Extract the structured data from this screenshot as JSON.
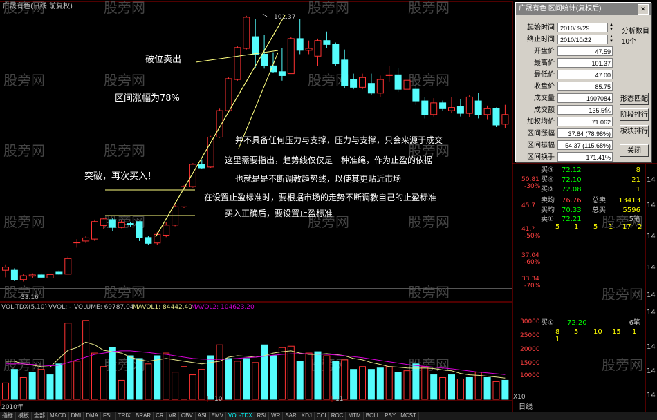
{
  "chart_header": {
    "title": "广晟有色(日线 前复权)",
    "high_marker": "101.37",
    "low_marker": "33.16"
  },
  "watermark": "股旁网",
  "annotations": [
    "破位卖出",
    "区间涨幅为78%",
    "并不具备任何压力与支撑，压力与支撑，只会来源于成交",
    "这里需要指出，趋势线仅仅是一种准绳，作为止盈的依据",
    "也就是是不断调教趋势线，以使其更贴近市场",
    "突破，再次买入！",
    "在设置止盈标准时，要根据市场的走势不断调教自己的止盈标准",
    "买入正确后，要设置止盈标准"
  ],
  "right_axis": [
    {
      "price": "50.81",
      "pct": "-30%"
    },
    {
      "price": "45.7",
      "pct": ""
    },
    {
      "price": "41.?",
      "pct": "-50%"
    },
    {
      "price": "37.04",
      "pct": "-60%"
    },
    {
      "price": "33.34",
      "pct": "-70%"
    }
  ],
  "vol_header": {
    "name": "VOL-TDX(5,10)",
    "vvol": "VVOL: -",
    "volume": "VOLUME: 69787.04",
    "mavol1": "MAVOL1: 84442.40",
    "mavol2": "MAVOL2: 104623.20"
  },
  "vol_axis": [
    "30000",
    "25000",
    "20000",
    "15000",
    "10000",
    "X10"
  ],
  "date_labels": [
    "2010年",
    "10",
    "11"
  ],
  "period_label": "日线",
  "dialog": {
    "title": "广晟有色 区间统计(复权后)",
    "rows": [
      {
        "label": "起始时间",
        "value": "2010/ 9/29"
      },
      {
        "label": "终止时间",
        "value": "2010/10/22"
      },
      {
        "label": "开盘价",
        "value": "47.59"
      },
      {
        "label": "最高价",
        "value": "101.37"
      },
      {
        "label": "最低价",
        "value": "47.00"
      },
      {
        "label": "收盘价",
        "value": "85.75"
      },
      {
        "label": "成交量",
        "value": "1907084"
      },
      {
        "label": "成交额",
        "value": "135.5亿"
      },
      {
        "label": "加权均价",
        "value": "71.062"
      },
      {
        "label": "区间涨幅",
        "value": "37.84 (78.98%)"
      },
      {
        "label": "区间振幅",
        "value": "54.37 (115.68%)"
      },
      {
        "label": "区间换手",
        "value": "171.41%"
      }
    ],
    "side_label": "分析数目",
    "side_count": "10个",
    "buttons": [
      "形态匹配",
      "阶段排行",
      "板块排行",
      "关闭"
    ]
  },
  "order_book": {
    "buys": [
      {
        "label": "买⑤",
        "price": "72.12",
        "vol": "8"
      },
      {
        "label": "买④",
        "price": "72.10",
        "vol": "21"
      },
      {
        "label": "买⑨",
        "price": "72.08",
        "vol": "1"
      }
    ],
    "summary": [
      {
        "label": "卖均",
        "price": "76.76",
        "label2": "总卖",
        "vol": "13413"
      },
      {
        "label": "买均",
        "price": "70.33",
        "label2": "总买",
        "vol": "5596"
      }
    ],
    "sell1": {
      "label": "卖①",
      "price": "72.21",
      "trail": "5笔"
    },
    "sell1_vols": [
      "5",
      "1",
      "5",
      "1",
      "17",
      "2"
    ],
    "buy1": {
      "label": "买①",
      "price": "72.20",
      "trail": "6笔"
    },
    "buy1_vols": [
      "8",
      "1",
      "5",
      "10",
      "15",
      "1"
    ],
    "time_ticks": [
      "14",
      "14",
      "14",
      "14",
      "14",
      "14",
      "14",
      "14",
      "14"
    ]
  },
  "tabs": [
    "指标",
    "模板",
    "全部",
    "MACD",
    "DMI",
    "DMA",
    "FSL",
    "TRIX",
    "BRAR",
    "CR",
    "VR",
    "OBV",
    "ASI",
    "EMV",
    "VOL-TDX",
    "RSI",
    "WR",
    "SAR",
    "KDJ",
    "CCI",
    "ROC",
    "MTM",
    "BOLL",
    "PSY",
    "MCST"
  ],
  "active_tab": "VOL-TDX",
  "colors": {
    "up": "#ff3232",
    "down": "#54fcfc",
    "ma1": "#e6e68a",
    "ma2": "#d400d4",
    "line_yellow": "#ffff80",
    "bg": "#000000"
  },
  "chart_data": {
    "type": "candlestick",
    "title": "广晟有色(日线 前复权)",
    "price_range": [
      30,
      104
    ],
    "volume_range": [
      0,
      32000
    ],
    "candles": [
      {
        "o": 36.0,
        "h": 37.5,
        "l": 34.2,
        "c": 36.8
      },
      {
        "o": 36.0,
        "h": 36.5,
        "l": 33.2,
        "c": 33.6
      },
      {
        "o": 33.6,
        "h": 35.0,
        "l": 33.1,
        "c": 34.6
      },
      {
        "o": 34.5,
        "h": 35.2,
        "l": 34.0,
        "c": 34.8
      },
      {
        "o": 34.8,
        "h": 35.2,
        "l": 34.0,
        "c": 34.2
      },
      {
        "o": 34.0,
        "h": 35.3,
        "l": 33.5,
        "c": 34.9
      },
      {
        "o": 35.5,
        "h": 36.0,
        "l": 34.8,
        "c": 35.0
      },
      {
        "o": 35.0,
        "h": 39.5,
        "l": 35.0,
        "c": 39.0
      },
      {
        "o": 43.2,
        "h": 44.0,
        "l": 41.8,
        "c": 43.2
      },
      {
        "o": 43.5,
        "h": 44.8,
        "l": 43.0,
        "c": 44.3
      },
      {
        "o": 44.0,
        "h": 49.0,
        "l": 43.5,
        "c": 48.5
      },
      {
        "o": 47.5,
        "h": 49.5,
        "l": 46.5,
        "c": 49.2
      },
      {
        "o": 49.0,
        "h": 49.5,
        "l": 46.0,
        "c": 47.0
      },
      {
        "o": 47.0,
        "h": 48.8,
        "l": 46.8,
        "c": 48.2
      },
      {
        "o": 48.0,
        "h": 48.4,
        "l": 47.2,
        "c": 47.8
      },
      {
        "o": 48.5,
        "h": 48.5,
        "l": 43.5,
        "c": 44.4
      },
      {
        "o": 44.4,
        "h": 44.9,
        "l": 42.6,
        "c": 42.9
      },
      {
        "o": 43.0,
        "h": 45.8,
        "l": 42.5,
        "c": 45.2
      },
      {
        "o": 45.0,
        "h": 48.3,
        "l": 44.5,
        "c": 47.6
      },
      {
        "o": 47.6,
        "h": 52.8,
        "l": 47.3,
        "c": 52.3
      },
      {
        "o": 52.3,
        "h": 57.8,
        "l": 52.0,
        "c": 57.5
      },
      {
        "o": 57.5,
        "h": 63.5,
        "l": 57.2,
        "c": 63.2
      },
      {
        "o": 63.2,
        "h": 64.5,
        "l": 62.0,
        "c": 62.3
      },
      {
        "o": 62.5,
        "h": 70.5,
        "l": 62.3,
        "c": 70.2
      },
      {
        "o": 70.2,
        "h": 77.5,
        "l": 70.0,
        "c": 77.0
      },
      {
        "o": 77.0,
        "h": 85.5,
        "l": 76.7,
        "c": 85.2
      },
      {
        "o": 85.0,
        "h": 93.5,
        "l": 84.7,
        "c": 93.2
      },
      {
        "o": 93.0,
        "h": 101.37,
        "l": 92.7,
        "c": 101.0
      },
      {
        "o": 96.0,
        "h": 100.5,
        "l": 88.0,
        "c": 91.5
      },
      {
        "o": 91.5,
        "h": 96.5,
        "l": 87.8,
        "c": 88.5
      },
      {
        "o": 88.5,
        "h": 92.0,
        "l": 86.7,
        "c": 87.0
      },
      {
        "o": 87.0,
        "h": 93.0,
        "l": 84.7,
        "c": 86.0
      },
      {
        "o": 86.5,
        "h": 96.0,
        "l": 86.5,
        "c": 95.5
      },
      {
        "o": 95.5,
        "h": 100.5,
        "l": 91.5,
        "c": 92.5
      },
      {
        "o": 92.5,
        "h": 95.0,
        "l": 91.5,
        "c": 93.0
      },
      {
        "o": 91.0,
        "h": 95.5,
        "l": 88.5,
        "c": 95.0
      },
      {
        "o": 95.0,
        "h": 97.3,
        "l": 93.0,
        "c": 94.0
      },
      {
        "o": 94.0,
        "h": 94.5,
        "l": 88.5,
        "c": 89.0
      },
      {
        "o": 90.0,
        "h": 92.7,
        "l": 82.7,
        "c": 83.5
      },
      {
        "o": 85.0,
        "h": 86.5,
        "l": 82.5,
        "c": 83.0
      },
      {
        "o": 83.0,
        "h": 86.5,
        "l": 82.5,
        "c": 85.5
      },
      {
        "o": 84.0,
        "h": 86.5,
        "l": 81.0,
        "c": 81.5
      },
      {
        "o": 81.5,
        "h": 86.0,
        "l": 80.5,
        "c": 85.0
      },
      {
        "o": 86.0,
        "h": 88.5,
        "l": 84.5,
        "c": 86.2
      },
      {
        "o": 86.2,
        "h": 88.0,
        "l": 81.8,
        "c": 82.5
      },
      {
        "o": 82.5,
        "h": 85.6,
        "l": 81.5,
        "c": 84.8
      },
      {
        "o": 82.5,
        "h": 84.0,
        "l": 78.5,
        "c": 79.5
      },
      {
        "o": 79.5,
        "h": 80.5,
        "l": 75.0,
        "c": 76.0
      },
      {
        "o": 76.0,
        "h": 80.2,
        "l": 75.5,
        "c": 79.0
      },
      {
        "o": 79.0,
        "h": 79.6,
        "l": 77.0,
        "c": 77.5
      },
      {
        "o": 77.0,
        "h": 80.5,
        "l": 76.5,
        "c": 77.8
      },
      {
        "o": 78.0,
        "h": 80.0,
        "l": 75.5,
        "c": 76.3
      },
      {
        "o": 76.3,
        "h": 81.0,
        "l": 75.3,
        "c": 80.5
      },
      {
        "o": 79.5,
        "h": 81.6,
        "l": 75.0,
        "c": 76.0
      },
      {
        "o": 76.0,
        "h": 78.3,
        "l": 74.8,
        "c": 77.5
      },
      {
        "o": 77.5,
        "h": 77.8,
        "l": 72.8,
        "c": 73.3
      },
      {
        "o": 73.5,
        "h": 78.5,
        "l": 72.5,
        "c": 76.0
      }
    ],
    "volume": [
      {
        "v": 6000,
        "up": true
      },
      {
        "v": 11000,
        "up": false
      },
      {
        "v": 8000,
        "up": true
      },
      {
        "v": 10000,
        "up": false
      },
      {
        "v": 11000,
        "up": true
      },
      {
        "v": 9000,
        "up": false
      },
      {
        "v": 13000,
        "up": false
      },
      {
        "v": 28000,
        "up": true
      },
      {
        "v": 14000,
        "up": true
      },
      {
        "v": 29000,
        "up": true
      },
      {
        "v": 17000,
        "up": true
      },
      {
        "v": 12000,
        "up": true
      },
      {
        "v": 19000,
        "up": false
      },
      {
        "v": 7000,
        "up": true
      },
      {
        "v": 16000,
        "up": false
      },
      {
        "v": 15000,
        "up": false
      },
      {
        "v": 13000,
        "up": true
      },
      {
        "v": 16000,
        "up": false
      },
      {
        "v": 17000,
        "up": true
      },
      {
        "v": 10000,
        "up": true
      },
      {
        "v": 12000,
        "up": true
      },
      {
        "v": 9000,
        "up": true
      },
      {
        "v": 11000,
        "up": true
      },
      {
        "v": 16000,
        "up": false
      },
      {
        "v": 20000,
        "up": true
      },
      {
        "v": 15000,
        "up": false
      },
      {
        "v": 14000,
        "up": true
      },
      {
        "v": 15000,
        "up": false
      },
      {
        "v": 13500,
        "up": true
      },
      {
        "v": 20000,
        "up": false
      },
      {
        "v": 16000,
        "up": false
      },
      {
        "v": 19000,
        "up": true
      },
      {
        "v": 19500,
        "up": true
      },
      {
        "v": 14000,
        "up": false
      },
      {
        "v": 17000,
        "up": true
      },
      {
        "v": 17500,
        "up": false
      },
      {
        "v": 16000,
        "up": true
      },
      {
        "v": 14000,
        "up": false
      },
      {
        "v": 14500,
        "up": true
      },
      {
        "v": 11000,
        "up": false
      },
      {
        "v": 12000,
        "up": true
      },
      {
        "v": 11000,
        "up": false
      },
      {
        "v": 11500,
        "up": false
      },
      {
        "v": 12000,
        "up": true
      },
      {
        "v": 10000,
        "up": false
      },
      {
        "v": 10500,
        "up": true
      },
      {
        "v": 13000,
        "up": false
      },
      {
        "v": 12000,
        "up": true
      },
      {
        "v": 9000,
        "up": false
      },
      {
        "v": 8000,
        "up": true
      },
      {
        "v": 9000,
        "up": false
      },
      {
        "v": 7500,
        "up": true
      },
      {
        "v": 8000,
        "up": false
      },
      {
        "v": 10000,
        "up": true
      },
      {
        "v": 8000,
        "up": false
      },
      {
        "v": 6500,
        "up": true
      },
      {
        "v": 7000,
        "up": false
      }
    ],
    "mavol1": [
      14000,
      14000,
      13000,
      12500,
      12000,
      11800,
      15000,
      18000,
      19000,
      21000,
      20000,
      18000,
      17500,
      17000,
      15500,
      14500,
      14000,
      14500,
      15000,
      14500,
      14000,
      13500,
      13000,
      13500,
      14000,
      15500,
      16000,
      15800,
      15500,
      16000,
      17000,
      17500,
      17800,
      17000,
      16500,
      16500,
      16800,
      16500,
      16000,
      15000,
      14500,
      13500,
      12800,
      12000,
      11800,
      11500,
      11400,
      11500,
      11300,
      10800,
      10500,
      9500,
      9000,
      8800,
      8500,
      8200,
      7800
    ],
    "mavol2": [
      13000,
      13000,
      13000,
      12800,
      12500,
      12300,
      12500,
      13500,
      14500,
      15500,
      16500,
      17000,
      17500,
      17800,
      17800,
      17500,
      17200,
      16800,
      16500,
      16000,
      15500,
      15000,
      14800,
      14700,
      14700,
      14800,
      15000,
      15300,
      15500,
      15800,
      16200,
      16500,
      16700,
      16800,
      16700,
      16600,
      16500,
      16300,
      16000,
      15700,
      15300,
      14800,
      14300,
      13800,
      13300,
      12800,
      12400,
      12100,
      11800,
      11500,
      11200,
      10800,
      10400,
      10000,
      9700,
      9400,
      9100
    ]
  }
}
